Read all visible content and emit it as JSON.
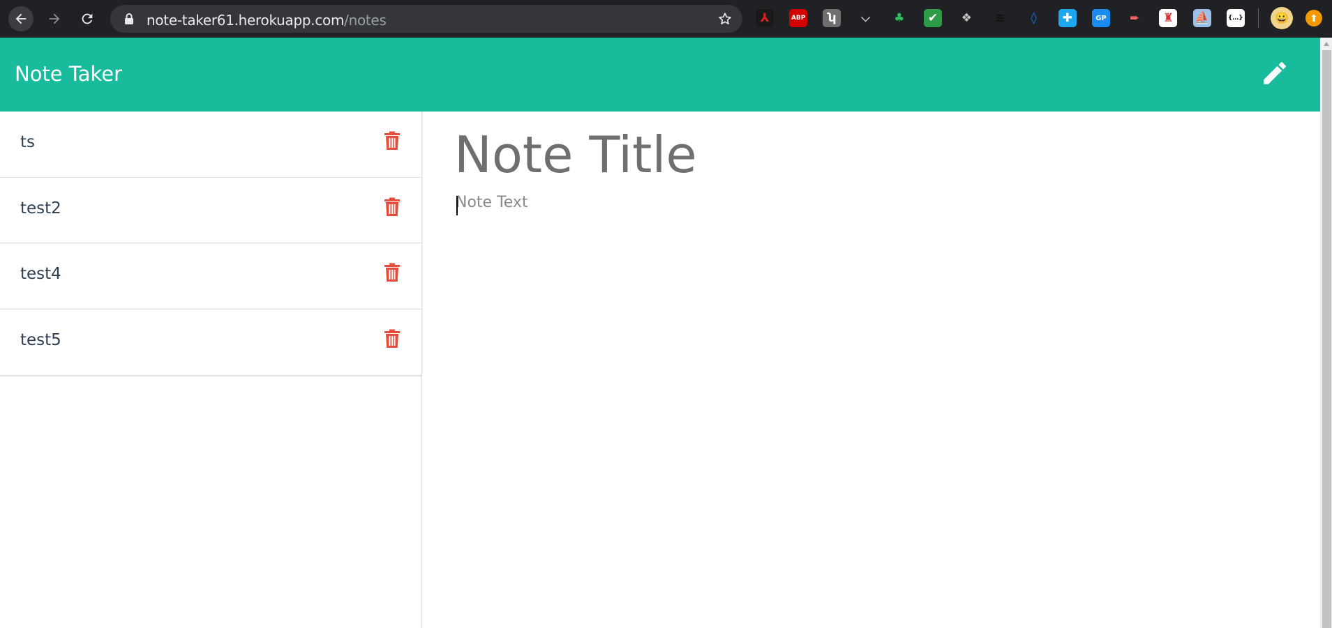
{
  "browser": {
    "url_host": "note-taker61.herokuapp.com",
    "url_path": "/notes",
    "extensions": [
      {
        "name": "acrobat-icon",
        "bg": "#1a1a1a",
        "fg": "#e02020",
        "glyph": "⅄"
      },
      {
        "name": "adblock-icon",
        "bg": "#d40000",
        "fg": "#ffffff",
        "glyph": "ABP"
      },
      {
        "name": "hubspot-icon",
        "bg": "#6f6f6f",
        "fg": "#ffffff",
        "glyph": "ʮ"
      },
      {
        "name": "pocket-icon",
        "bg": "transparent",
        "fg": "#c7c7c7",
        "glyph": "⌵"
      },
      {
        "name": "evernote-icon",
        "bg": "transparent",
        "fg": "#2dbe60",
        "glyph": "♣"
      },
      {
        "name": "checkmark-icon",
        "bg": "#2e9c46",
        "fg": "#ffffff",
        "glyph": "✔"
      },
      {
        "name": "dropbox-icon",
        "bg": "transparent",
        "fg": "#c7c7c7",
        "glyph": "❖"
      },
      {
        "name": "buffer-icon",
        "bg": "transparent",
        "fg": "#111111",
        "glyph": "≋"
      },
      {
        "name": "drop-icon",
        "bg": "transparent",
        "fg": "#1a73e8",
        "glyph": "◊"
      },
      {
        "name": "puzzle-blue-icon",
        "bg": "#1ea7f0",
        "fg": "#ffffff",
        "glyph": "✚"
      },
      {
        "name": "gp-icon",
        "bg": "#1a8cf0",
        "fg": "#ffffff",
        "glyph": "GP"
      },
      {
        "name": "record-icon",
        "bg": "transparent",
        "fg": "#f06060",
        "glyph": "➨"
      },
      {
        "name": "tower-icon",
        "bg": "#ffffff",
        "fg": "#d83030",
        "glyph": "♜"
      },
      {
        "name": "ship-icon",
        "bg": "#9ec0e8",
        "fg": "#ffffff",
        "glyph": "⛵"
      },
      {
        "name": "json-icon",
        "bg": "#ffffff",
        "fg": "#000000",
        "glyph": "{…}"
      }
    ]
  },
  "app": {
    "brand": "Note Taker",
    "notes": [
      {
        "title": "ts"
      },
      {
        "title": "test2"
      },
      {
        "title": "test4"
      },
      {
        "title": "test5"
      }
    ],
    "editor": {
      "title_placeholder": "Note Title",
      "text_placeholder": "Note Text"
    }
  },
  "colors": {
    "navbar": "#18bc9c",
    "delete": "#e74c3c"
  }
}
